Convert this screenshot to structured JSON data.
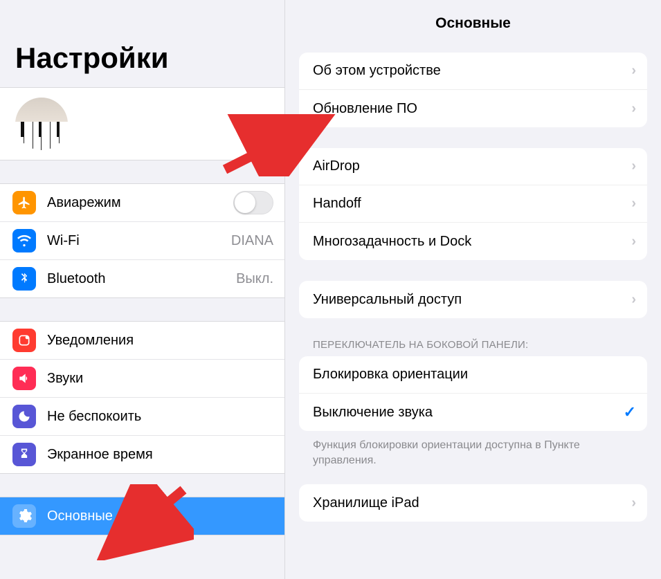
{
  "sidebar": {
    "title": "Настройки",
    "group1": [
      {
        "icon": "plane-icon",
        "label": "Авиарежим",
        "value": null,
        "toggle": true
      },
      {
        "icon": "wifi-icon",
        "label": "Wi-Fi",
        "value": "DIANA"
      },
      {
        "icon": "bluetooth-icon",
        "label": "Bluetooth",
        "value": "Выкл."
      }
    ],
    "group2": [
      {
        "icon": "notifications-icon",
        "label": "Уведомления"
      },
      {
        "icon": "sound-icon",
        "label": "Звуки"
      },
      {
        "icon": "dnd-icon",
        "label": "Не беспокоить"
      },
      {
        "icon": "screentime-icon",
        "label": "Экранное время"
      }
    ],
    "group3": [
      {
        "icon": "gear-icon",
        "label": "Основные",
        "selected": true
      }
    ]
  },
  "detail": {
    "title": "Основные",
    "group1": [
      "Об этом устройстве",
      "Обновление ПО"
    ],
    "group2": [
      "AirDrop",
      "Handoff",
      "Многозадачность и Dock"
    ],
    "group3": [
      "Универсальный доступ"
    ],
    "sideSwitch": {
      "header": "ПЕРЕКЛЮЧАТЕЛЬ НА БОКОВОЙ ПАНЕЛИ:",
      "items": [
        {
          "label": "Блокировка ориентации",
          "checked": false
        },
        {
          "label": "Выключение звука",
          "checked": true
        }
      ],
      "footer": "Функция блокировки ориентации доступна в Пункте управления."
    },
    "group5": [
      "Хранилище iPad"
    ]
  }
}
